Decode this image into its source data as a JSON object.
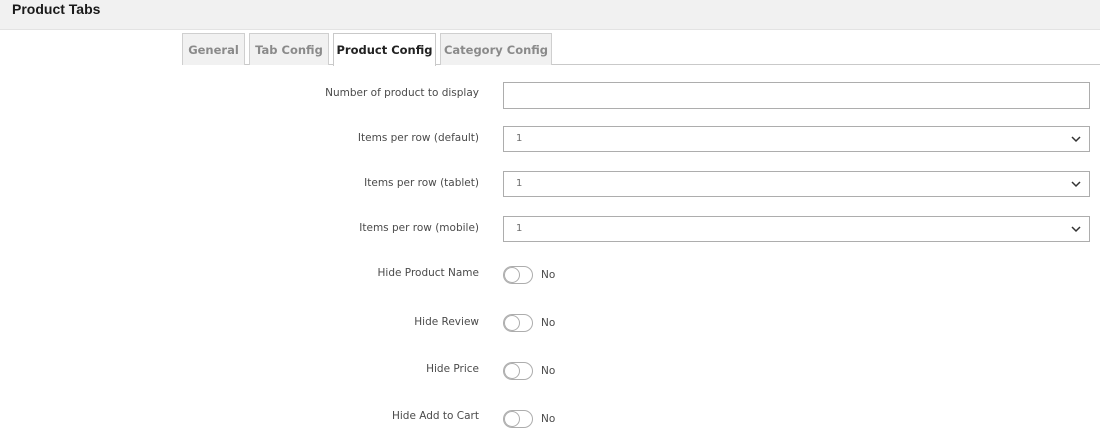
{
  "header": {
    "title": "Product Tabs"
  },
  "tabs": [
    {
      "label": "General",
      "active": false
    },
    {
      "label": "Tab Config",
      "active": false
    },
    {
      "label": "Product Config",
      "active": true
    },
    {
      "label": "Category Config",
      "active": false
    }
  ],
  "form": {
    "number_of_products": {
      "label": "Number of product to display",
      "value": ""
    },
    "items_default": {
      "label": "Items per row (default)",
      "value": "1"
    },
    "items_tablet": {
      "label": "Items per row (tablet)",
      "value": "1"
    },
    "items_mobile": {
      "label": "Items per row (mobile)",
      "value": "1"
    },
    "hide_product_name": {
      "label": "Hide Product Name",
      "state": "No"
    },
    "hide_review": {
      "label": "Hide Review",
      "state": "No"
    },
    "hide_price": {
      "label": "Hide Price",
      "state": "No"
    },
    "hide_add_to_cart": {
      "label": "Hide Add to Cart",
      "state": "No"
    }
  }
}
